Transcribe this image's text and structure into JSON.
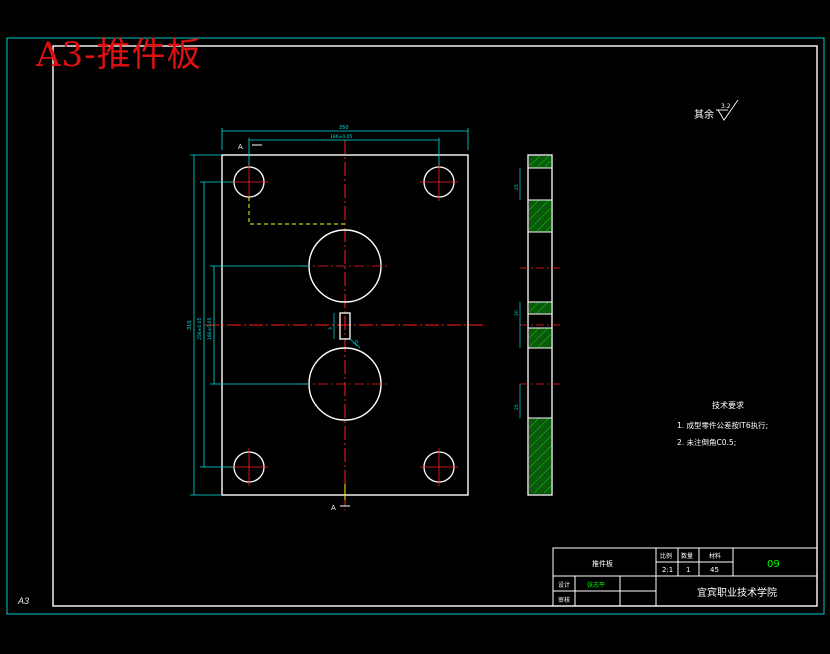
{
  "overlay_title": "A3-推件板",
  "sheet_size_label": "A3",
  "roughness_note": {
    "prefix": "其余",
    "value": "3.2"
  },
  "technical_requirements": {
    "heading": "技术要求",
    "items": [
      "1. 成型零件公差按IT6执行;",
      "2. 未注倒角C0.5;"
    ]
  },
  "section_marker": "A",
  "dimensions": {
    "overall_width": "250",
    "hole_spacing_x": "186±0.05",
    "overall_height": "310",
    "hole_spacing_y_outer": "256±0.05",
    "hole_spacing_y_inner": "180±0.05",
    "slot_size": "3",
    "slot_offset": "20",
    "side_a": "25",
    "side_b": "20",
    "side_c": "25"
  },
  "title_block": {
    "part_name": "推件板",
    "scale_header": "比例",
    "qty_header": "数量",
    "material_header": "材料",
    "scale_value": "2:1",
    "qty_value": "1",
    "material_value": "45",
    "drawing_no": "09",
    "designer_label": "设计",
    "designer_name": "张志平",
    "checker_label": "审核",
    "school": "宜宾职业技术学院"
  },
  "colors": {
    "line": "#ffffff",
    "border": "#00ffff",
    "center": "#ff2020",
    "dim": "#00ffff",
    "hatch": "#00ff00",
    "title_red": "#e01010",
    "yellow": "#ffff00"
  }
}
